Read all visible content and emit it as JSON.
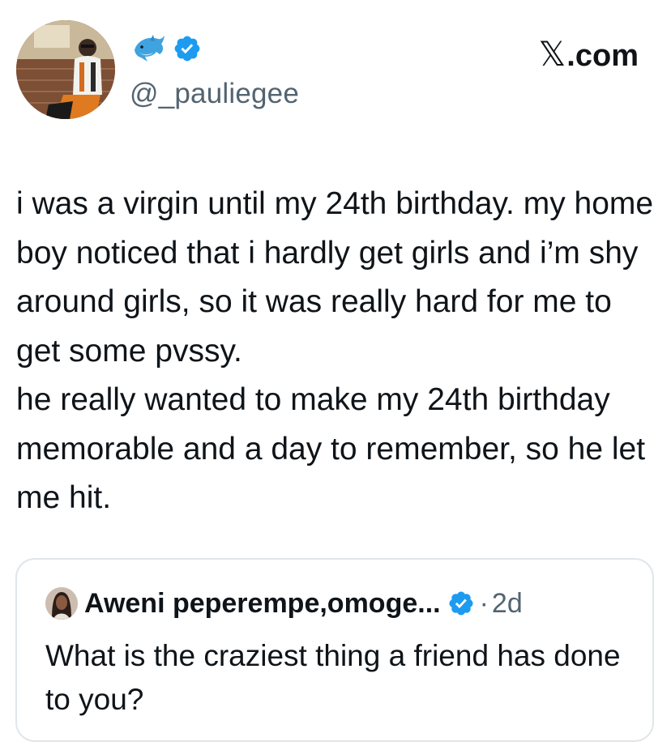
{
  "author": {
    "avatar_icon": "profile-photo-man-sitting-by-brick-wall",
    "emoji_icon": "dolphin-icon",
    "verified_icon": "verified-badge-icon",
    "handle": "@_pauliegee"
  },
  "brand": {
    "x_mark": "𝕏",
    "label": ".com"
  },
  "tweet": {
    "text": "i was a virgin until my 24th birthday. my home boy noticed that i hardly get girls and i’m shy around girls, so it was really hard for me to get some pvssy.\nhe really wanted to make my 24th birthday memorable and a day to remember, so he let me hit."
  },
  "quoted_tweet": {
    "avatar_icon": "profile-photo-woman",
    "name": "Aweni peperempe,omoge...",
    "verified_icon": "verified-badge-icon",
    "separator": "·",
    "time": "2d",
    "text": "What is the craziest thing a friend has done to you?"
  },
  "colors": {
    "text_primary": "#0f1419",
    "text_secondary": "#536471",
    "verified_blue": "#1d9bf0",
    "card_border": "#e1e6ea"
  }
}
